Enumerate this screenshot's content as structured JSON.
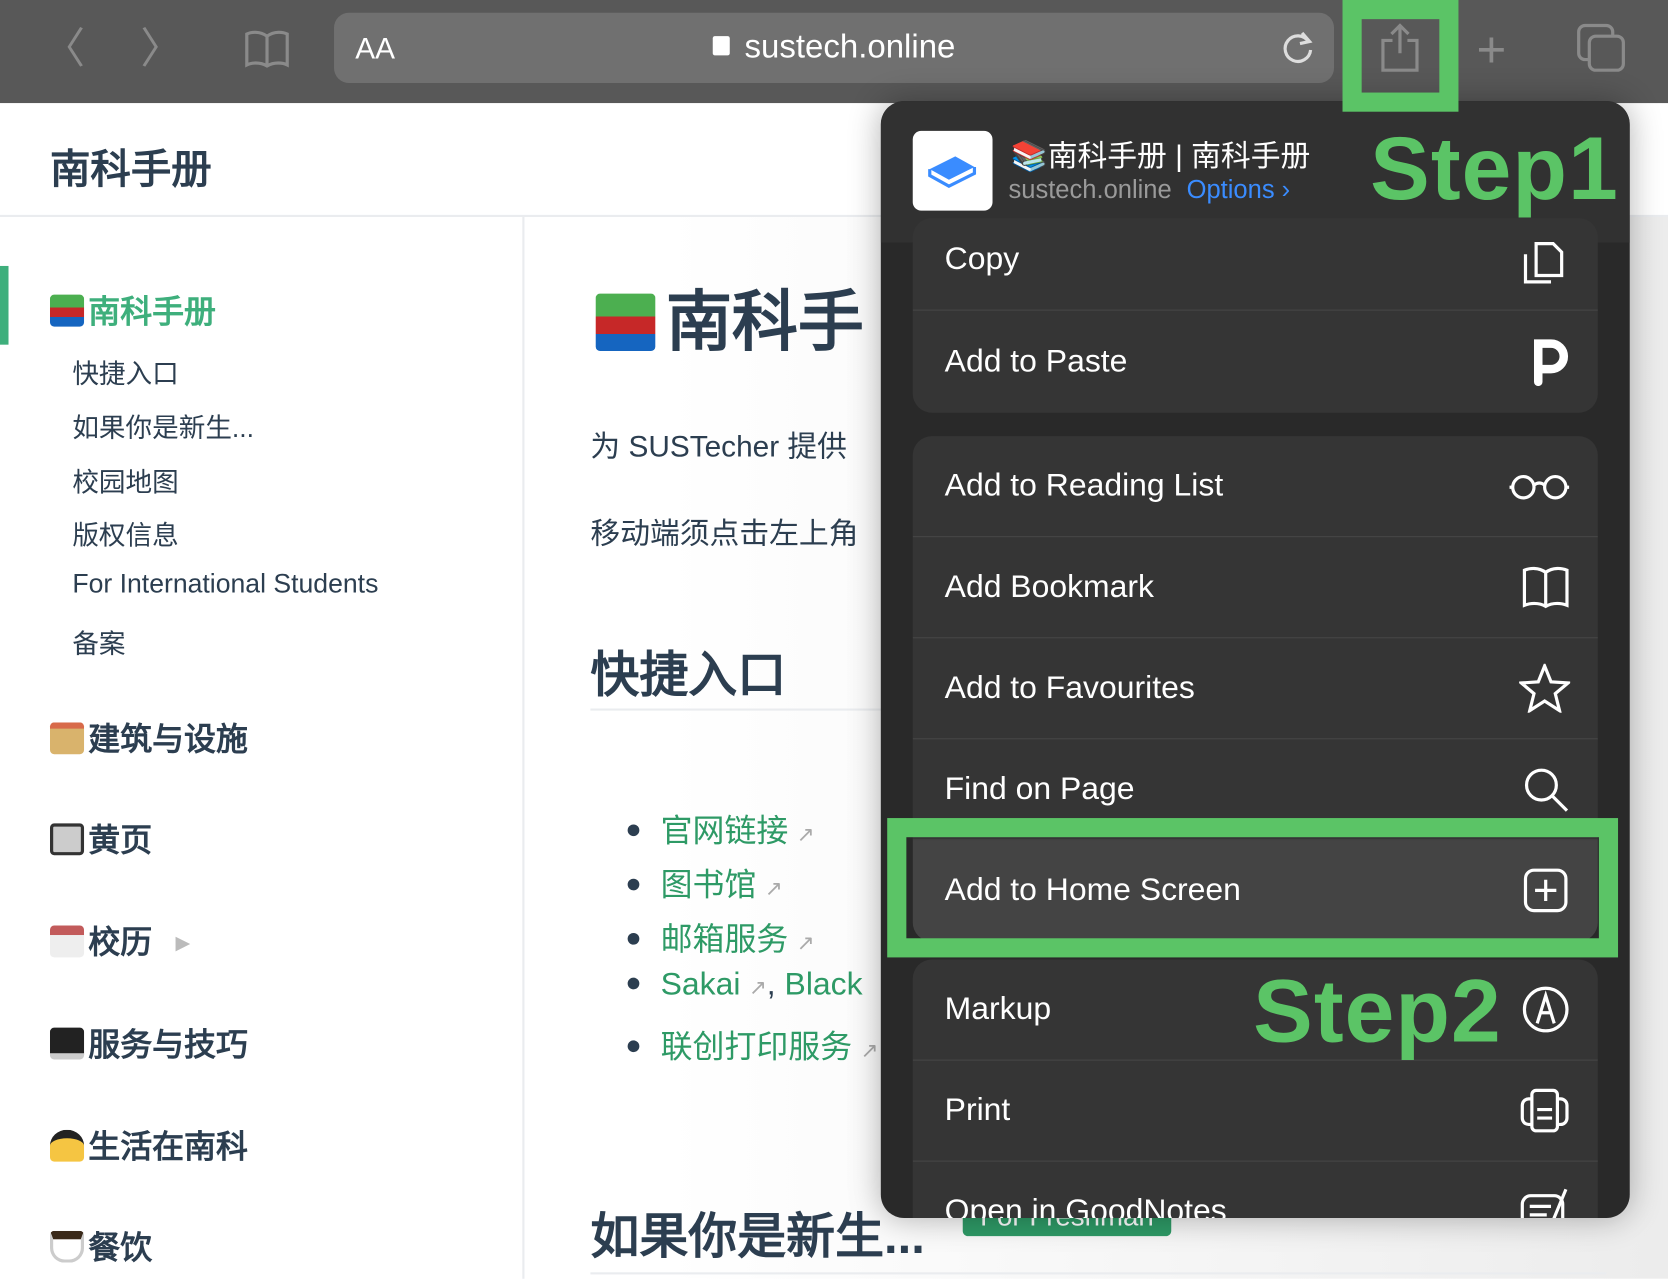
{
  "browser": {
    "url": "sustech.online",
    "text_size_label": "AA",
    "icons": [
      "back-icon",
      "forward-icon",
      "bookmarks-icon",
      "lock-icon",
      "reload-icon",
      "share-icon",
      "new-tab-icon",
      "tabs-icon"
    ]
  },
  "site": {
    "title": "南科手册"
  },
  "sidebar": {
    "active": "南科手册",
    "sub_items": [
      "快捷入口",
      "如果你是新生...",
      "校园地图",
      "版权信息",
      "For International Students",
      "备案"
    ],
    "groups": [
      {
        "label": "建筑与设施",
        "icon": "school-building-icon"
      },
      {
        "label": "黄页",
        "icon": "fax-icon"
      },
      {
        "label": "校历",
        "icon": "calendar-icon",
        "expandable": true
      },
      {
        "label": "服务与技巧",
        "icon": "desktop-icon"
      },
      {
        "label": "生活在南科",
        "icon": "student-icon"
      },
      {
        "label": "餐饮",
        "icon": "coffee-icon"
      }
    ]
  },
  "main": {
    "title": "南科手",
    "intro": "为 SUSTecher 提供",
    "mobile_hint": "移动端须点击左上角",
    "section1": "快捷入口",
    "links": [
      "官网链接",
      "图书馆",
      "邮箱服务",
      "Sakai",
      "Black",
      "联创打印服务"
    ],
    "comma": ",",
    "section2": "如果你是新生...",
    "badge": "For Freshman"
  },
  "share_sheet": {
    "title": "📚南科手册 | 南科手册",
    "subtitle": "sustech.online",
    "options": "Options ›",
    "group1": [
      "Copy",
      "Add to Paste"
    ],
    "group2": [
      "Add to Reading List",
      "Add Bookmark",
      "Add to Favourites",
      "Find on Page",
      "Add to Home Screen"
    ],
    "group3": [
      "Markup",
      "Print",
      "Open in GoodNotes"
    ]
  },
  "annotations": {
    "step1": "Step1",
    "step2": "Step2",
    "color": "#5bc466"
  },
  "colors": {
    "accent": "#3eaf7c",
    "link": "#2e9a66",
    "text": "#2c3e50",
    "options_blue": "#3a8cff"
  }
}
